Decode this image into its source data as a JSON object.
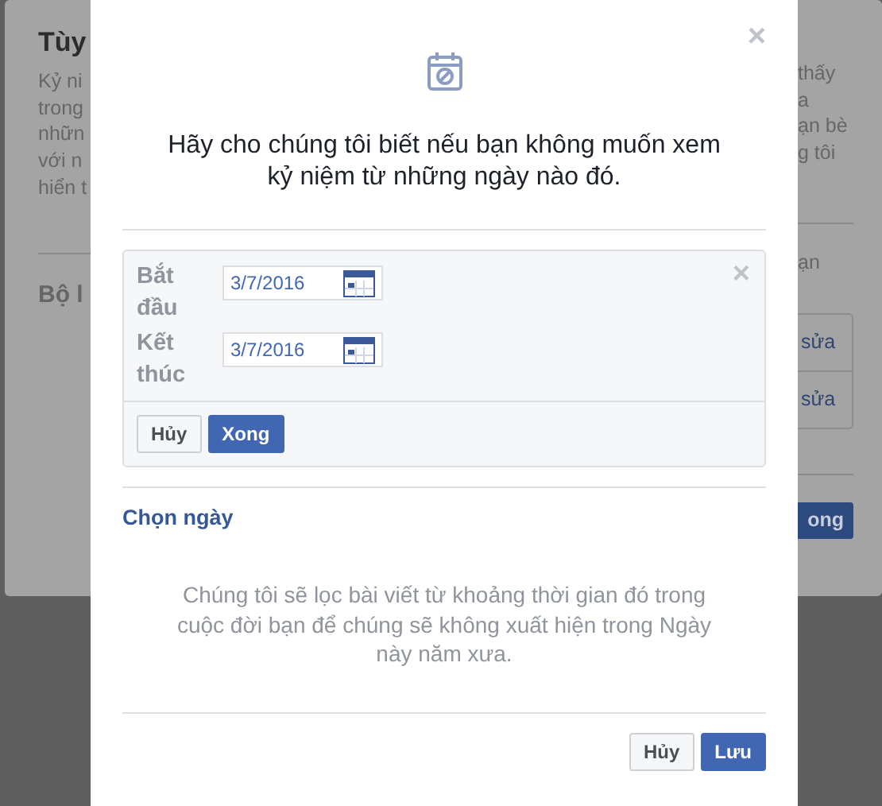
{
  "background_dialog": {
    "left": {
      "title": "Tùy",
      "description_lines": [
        "Kỷ ni",
        "trong",
        "nhữn",
        "với n",
        "hiển t"
      ],
      "filter_heading": "Bộ l"
    },
    "right": {
      "description_lines": [
        "thấy",
        "a",
        "ạn bè",
        "g tôi"
      ],
      "filter_text": "ạn",
      "edit_links": [
        "sửa",
        "sửa"
      ],
      "done_button": "ong"
    }
  },
  "modal": {
    "close": "×",
    "message": "Hãy cho chúng tôi biết nếu bạn không muốn xem kỷ niệm từ những ngày nào đó.",
    "filter": {
      "close": "×",
      "fields": [
        {
          "label": "Bắt đầu",
          "value": "3/7/2016"
        },
        {
          "label": "Kết thúc",
          "value": "3/7/2016"
        }
      ],
      "cancel": "Hủy",
      "done": "Xong"
    },
    "choose_date": "Chọn ngày",
    "note": "Chúng tôi sẽ lọc bài viết từ khoảng thời gian đó trong cuộc đời bạn để chúng sẽ không xuất hiện trong Ngày này năm xưa.",
    "buttons": {
      "cancel": "Hủy",
      "save": "Lưu"
    }
  }
}
